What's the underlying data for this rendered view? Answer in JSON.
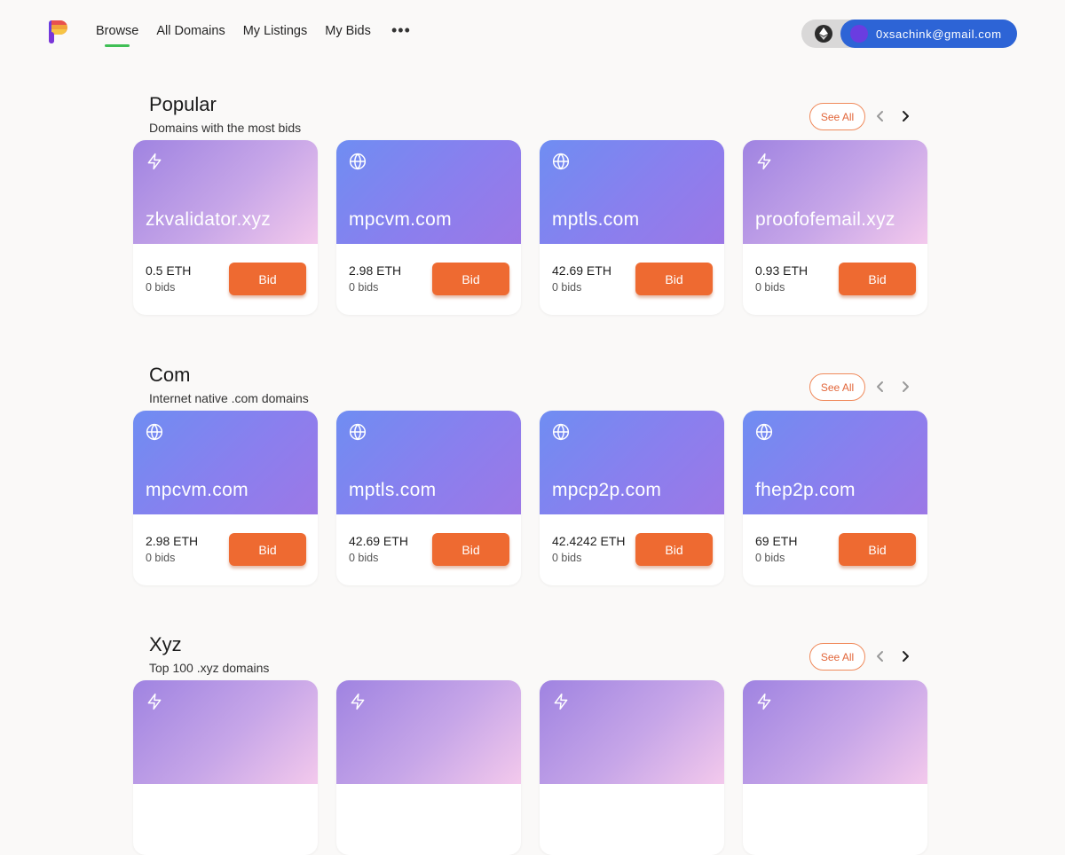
{
  "nav": {
    "items": [
      {
        "label": "Browse",
        "active": true
      },
      {
        "label": "All Domains"
      },
      {
        "label": "My Listings"
      },
      {
        "label": "My Bids"
      }
    ],
    "more_icon": "more-horizontal-icon"
  },
  "account": {
    "network_icon": "ethereum-icon",
    "email": "0xsachink@gmail.com"
  },
  "sections": [
    {
      "title": "Popular",
      "subtitle": "Domains with the most bids",
      "see_all": "See All",
      "prev_enabled": false,
      "next_enabled": true,
      "cards": [
        {
          "domain": "zkvalidator.xyz",
          "icon": "zap-icon",
          "theme": "pink",
          "price": "0.5 ETH",
          "bids": "0 bids",
          "bid_label": "Bid"
        },
        {
          "domain": "mpcvm.com",
          "icon": "globe-icon",
          "theme": "blue",
          "price": "2.98 ETH",
          "bids": "0 bids",
          "bid_label": "Bid"
        },
        {
          "domain": "mptls.com",
          "icon": "globe-icon",
          "theme": "blue",
          "price": "42.69 ETH",
          "bids": "0 bids",
          "bid_label": "Bid"
        },
        {
          "domain": "proofofemail.xyz",
          "icon": "zap-icon",
          "theme": "pink",
          "price": "0.93 ETH",
          "bids": "0 bids",
          "bid_label": "Bid"
        }
      ]
    },
    {
      "title": "Com",
      "subtitle": "Internet native .com domains",
      "see_all": "See All",
      "prev_enabled": false,
      "next_enabled": false,
      "cards": [
        {
          "domain": "mpcvm.com",
          "icon": "globe-icon",
          "theme": "blue",
          "price": "2.98 ETH",
          "bids": "0 bids",
          "bid_label": "Bid"
        },
        {
          "domain": "mptls.com",
          "icon": "globe-icon",
          "theme": "blue",
          "price": "42.69 ETH",
          "bids": "0 bids",
          "bid_label": "Bid"
        },
        {
          "domain": "mpcp2p.com",
          "icon": "globe-icon",
          "theme": "blue",
          "price": "42.4242 ETH",
          "bids": "0 bids",
          "bid_label": "Bid"
        },
        {
          "domain": "fhep2p.com",
          "icon": "globe-icon",
          "theme": "blue",
          "price": "69 ETH",
          "bids": "0 bids",
          "bid_label": "Bid"
        }
      ]
    },
    {
      "title": "Xyz",
      "subtitle": "Top 100 .xyz domains",
      "see_all": "See All",
      "prev_enabled": false,
      "next_enabled": true,
      "cards": [
        {
          "domain": "",
          "icon": "zap-icon",
          "theme": "pink",
          "price": "",
          "bids": "",
          "bid_label": ""
        },
        {
          "domain": "",
          "icon": "zap-icon",
          "theme": "pink",
          "price": "",
          "bids": "",
          "bid_label": ""
        },
        {
          "domain": "",
          "icon": "zap-icon",
          "theme": "pink",
          "price": "",
          "bids": "",
          "bid_label": ""
        },
        {
          "domain": "",
          "icon": "zap-icon",
          "theme": "pink",
          "price": "",
          "bids": "",
          "bid_label": ""
        }
      ]
    }
  ],
  "colors": {
    "accent": "#ee6a31",
    "active_nav": "#3fbf55",
    "account_pill": "#2d64d6",
    "avatar": "#6a3de0"
  }
}
